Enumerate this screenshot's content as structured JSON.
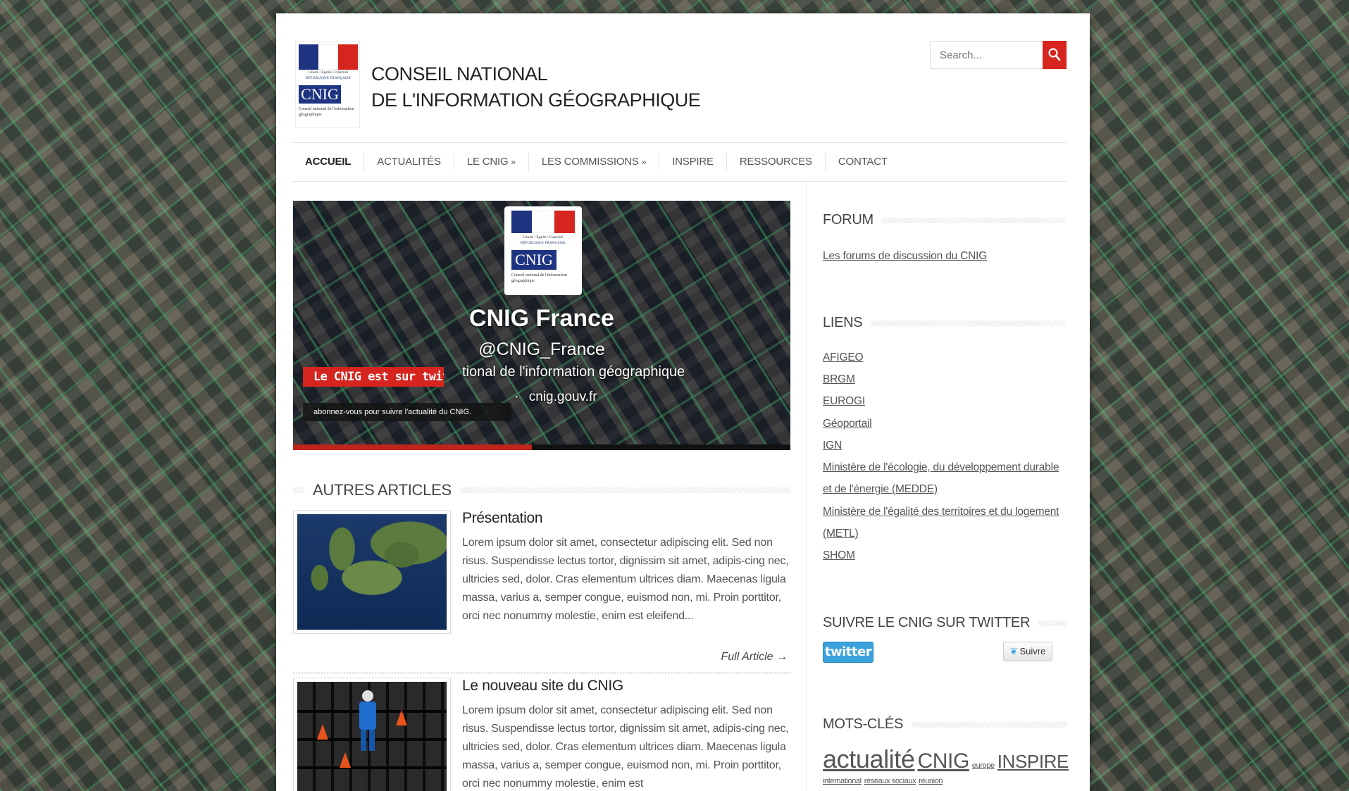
{
  "header": {
    "logo": {
      "motto": "Liberté • Égalité • Fraternité",
      "republic": "RÉPUBLIQUE FRANÇAISE",
      "badge": "CNIG",
      "subtitle": "Conseil national de l'information géographique",
      "flag_colors": [
        "#1f3480",
        "#ffffff",
        "#d6241e"
      ]
    },
    "title_line1": "CONSEIL NATIONAL",
    "title_line2": "DE L'INFORMATION GÉOGRAPHIQUE",
    "search_placeholder": "Search..."
  },
  "nav": {
    "items": [
      {
        "label": "ACCUEIL"
      },
      {
        "label": "ACTUALITÉS"
      },
      {
        "label": "LE CNIG",
        "more": "»"
      },
      {
        "label": "LES COMMISSIONS",
        "more": "»"
      },
      {
        "label": "INSPIRE"
      },
      {
        "label": "RESSOURCES"
      },
      {
        "label": "CONTACT"
      }
    ]
  },
  "slider": {
    "title": "CNIG France",
    "handle": "@CNIG_France",
    "description": "tional de l'information géographique",
    "site": "cnig.gouv.fr",
    "caption_title": "Le CNIG est sur twit-",
    "caption_text": "abonnez-vous pour suivre l'actualité du CNIG.",
    "progress": 0.48,
    "accent_color": "#c0251d"
  },
  "articles_section": {
    "title": "AUTRES ARTICLES",
    "items": [
      {
        "title": "Présentation",
        "body": "Lorem ipsum dolor sit amet, consectetur adipiscing elit. Sed non risus. Suspendisse lectus tortor, dignissim sit amet, adipis-cing nec, ultricies sed, dolor. Cras elementum ultrices diam. Maecenas ligula massa, varius a, semper congue, euismod non, mi. Proin porttitor, orci nec nonummy molestie, enim est eleifend...",
        "more": "Full Article →"
      },
      {
        "title": "Le nouveau site du CNIG",
        "body": "Lorem ipsum dolor sit amet, consectetur adipiscing elit. Sed non risus. Suspendisse lectus tortor, dignissim sit amet, adipis-cing nec, ultricies sed, dolor. Cras elementum ultrices diam. Maecenas ligula massa, varius a, semper congue, euismod non, mi. Proin porttitor, orci nec nonummy molestie, enim est"
      }
    ]
  },
  "sidebar": {
    "forum": {
      "title": "FORUM",
      "link": "Les forums de discussion du CNIG"
    },
    "liens": {
      "title": "LIENS",
      "links": [
        "AFIGEO",
        "BRGM",
        "EUROGI",
        "Géoportail",
        "IGN",
        "Ministère de l'écologie, du développement durable",
        "et de l'énergie (MEDDE)",
        "Ministère de l'égalité des territoires et du logement",
        "(METL)",
        "SHOM"
      ]
    },
    "twitter": {
      "title": "SUIVRE LE CNIG SUR TWITTER",
      "logo_text": "twitter",
      "follow_label": "Suivre",
      "brand_color": "#3aa3dd"
    },
    "tags": {
      "title": "MOTS-CLÉS",
      "items": [
        {
          "label": "actualité",
          "size": "xl"
        },
        {
          "label": "CNIG",
          "size": "l"
        },
        {
          "label": "europe",
          "size": "xs"
        },
        {
          "label": "INSPIRE",
          "size": "m"
        },
        {
          "label": "international",
          "size": "xxs"
        },
        {
          "label": "réseaux sociaux",
          "size": "xxs"
        },
        {
          "label": "réunion",
          "size": "xxs"
        }
      ]
    }
  }
}
